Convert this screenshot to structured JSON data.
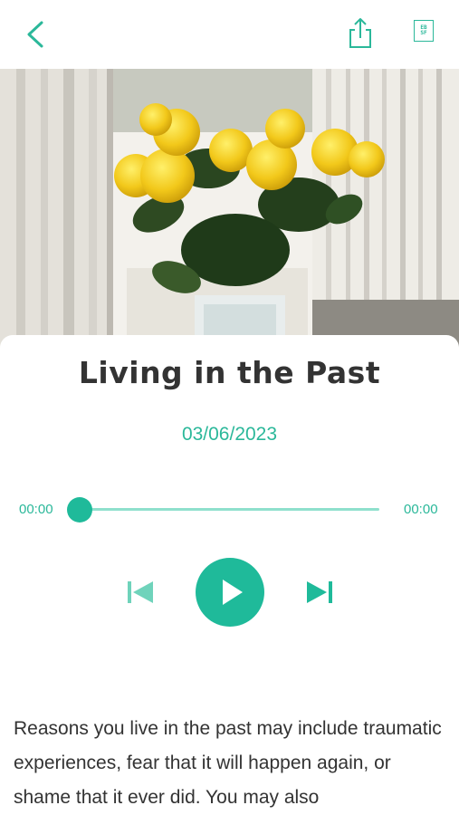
{
  "header": {
    "back_icon": "chevron-left-icon",
    "share_icon": "share-icon",
    "text_size_icon": "text-size-icon",
    "text_size_glyph": "EB\nSF",
    "accent": "#2bb89a"
  },
  "hero": {
    "subject": "yellow-roses-vase-photo"
  },
  "episode": {
    "title": "Living in the Past",
    "date": "03/06/2023"
  },
  "player": {
    "elapsed": "00:00",
    "duration": "00:00",
    "progress": 0,
    "prev_icon": "skip-previous-icon",
    "play_icon": "play-icon",
    "next_icon": "skip-next-icon"
  },
  "content": {
    "text": "Reasons you live in the past may include traumatic experiences, fear that it will happen again, or shame that it ever did. You may also"
  }
}
